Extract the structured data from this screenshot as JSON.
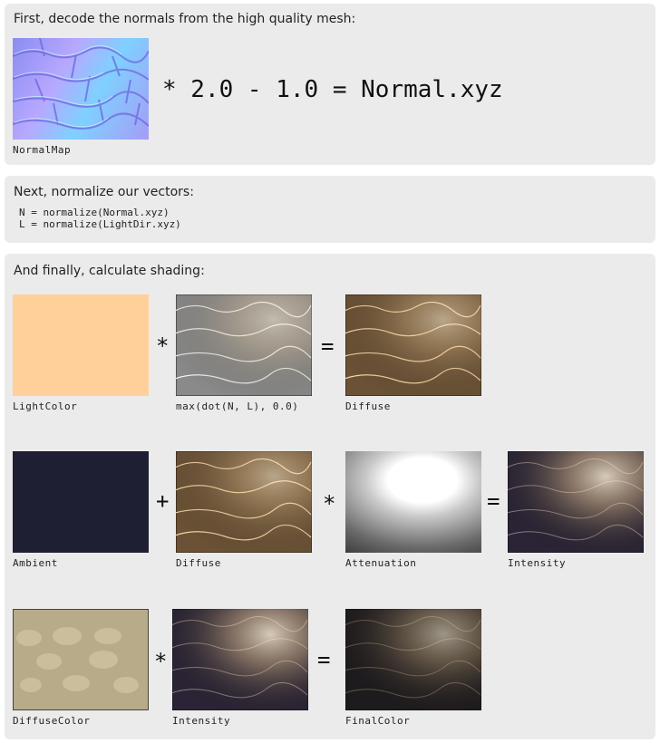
{
  "step1": {
    "heading": "First, decode the normals from the high quality mesh:",
    "tile_caption": "NormalMap",
    "formula": "* 2.0 - 1.0 = Normal.xyz"
  },
  "step2": {
    "heading": "Next, normalize our vectors:",
    "code_line1": "N = normalize(Normal.xyz)",
    "code_line2": "L = normalize(LightDir.xyz)"
  },
  "step3": {
    "heading": "And finally, calculate shading:",
    "row1": {
      "a": "LightColor",
      "op1": "*",
      "b": "max(dot(N, L), 0.0)",
      "op2": "=",
      "c": "Diffuse"
    },
    "row2": {
      "a": "Ambient",
      "op1": "+",
      "b": "Diffuse",
      "op2": "*",
      "c": "Attenuation",
      "op3": "=",
      "d": "Intensity"
    },
    "row3": {
      "a": "DiffuseColor",
      "op1": "*",
      "b": "Intensity",
      "op2": "=",
      "c": "FinalColor"
    }
  },
  "colors": {
    "panel_bg": "#ebebeb",
    "light_color": "#ffd09a",
    "ambient": "#1f1f33"
  }
}
